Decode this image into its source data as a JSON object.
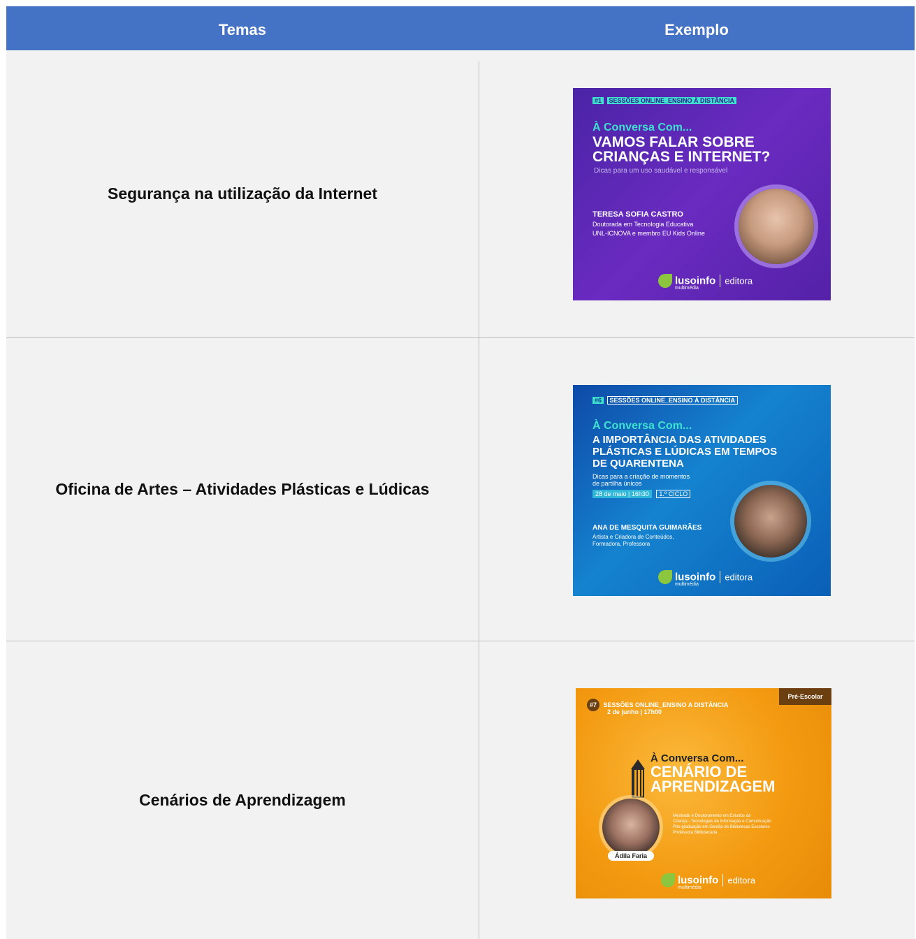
{
  "header": {
    "col_topics": "Temas",
    "col_example": "Exemplo"
  },
  "rows": [
    {
      "topic": "Segurança na utilização da Internet",
      "poster": {
        "tag_num": "#1",
        "tag_text": "SESSÕES ONLINE_ENSINO À DISTÂNCIA",
        "lead": "À Conversa Com...",
        "title_line1": "VAMOS FALAR SOBRE",
        "title_line2": "CRIANÇAS E INTERNET?",
        "subtitle": "Dicas para um uso saudável e responsável",
        "speaker": "TERESA SOFIA CASTRO",
        "role_line1": "Doutorada em Tecnologia Educativa",
        "role_line2": "UNL-ICNOVA e membro EU Kids Online",
        "logo": "lusoinfo",
        "logo_sub": "multimédia",
        "logo_editora": "editora"
      }
    },
    {
      "topic": "Oficina de Artes – Atividades Plásticas e Lúdicas",
      "poster": {
        "tag_num": "#6",
        "tag_text": "SESSÕES ONLINE_ENSINO À DISTÂNCIA",
        "lead": "À Conversa Com...",
        "title_line1": "A IMPORTÂNCIA DAS ATIVIDADES",
        "title_line2": "PLÁSTICAS E LÚDICAS EM TEMPOS",
        "title_line3": "DE QUARENTENA",
        "subtitle_line1": "Dicas para a criação de momentos",
        "subtitle_line2": "de partilha únicos",
        "date": "28 de maio | 16h30",
        "level": "1.º CICLO",
        "speaker": "ANA DE MESQUITA GUIMARÃES",
        "role_line1": "Artista e Criadora de Conteúdos,",
        "role_line2": "Formadora, Professora",
        "logo": "lusoinfo",
        "logo_sub": "multimédia",
        "logo_editora": "editora"
      }
    },
    {
      "topic": "Cenários de Aprendizagem",
      "poster": {
        "tag_num": "#7",
        "tag_text": "SESSÕES ONLINE_ENSINO A DISTÂNCIA",
        "date": "2 de junho | 17h00",
        "level": "Pré-Escolar",
        "lead": "À Conversa Com...",
        "title_line1": "CENÁRIO DE",
        "title_line2": "APRENDIZAGEM",
        "bio_line1": "Mestrado e Doutoramento em Estudos da",
        "bio_line2": "Criança - Tecnologias de Informação e Comunicação",
        "bio_line3": "Pós-graduação em Gestão de Bibliotecas Escolares",
        "bio_line4": "Professora Bibliotecária",
        "speaker": "Ádila Faria",
        "logo": "lusoinfo",
        "logo_sub": "multimédia",
        "logo_editora": "editora"
      }
    }
  ],
  "colors": {
    "header": "#4472c4",
    "row_bg": "#f2f2f2",
    "accent_cyan": "#3fe0d0"
  }
}
